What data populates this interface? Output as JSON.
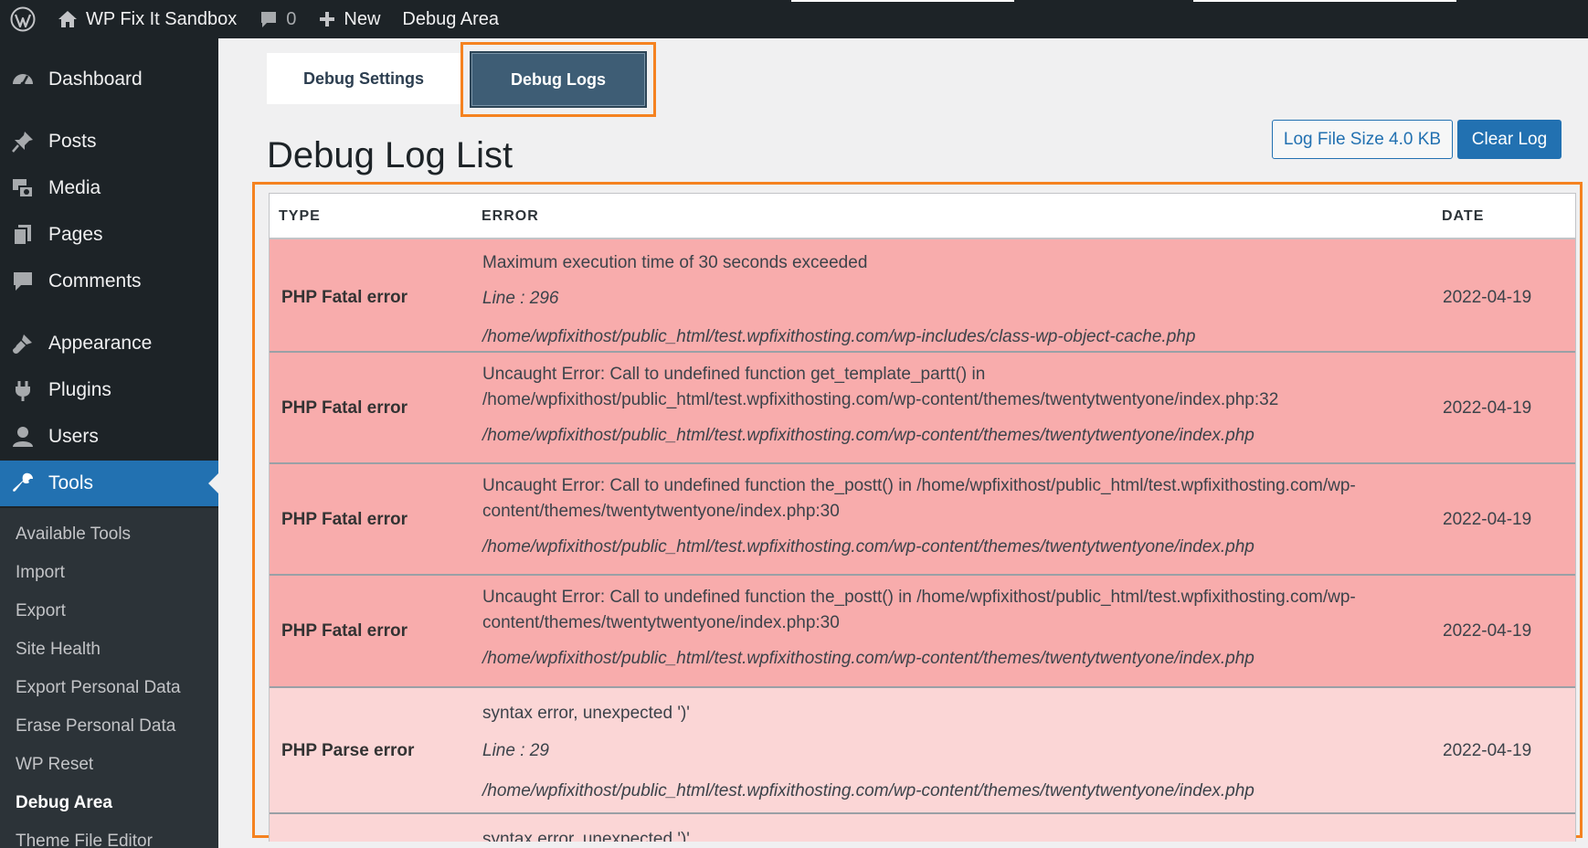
{
  "admin_bar": {
    "site_name": "WP Fix It Sandbox",
    "comments_count": "0",
    "new_label": "New",
    "debug_label": "Debug Area"
  },
  "sidebar": {
    "items": [
      {
        "label": "Dashboard",
        "icon": "dashboard-icon"
      },
      {
        "label": "Posts",
        "icon": "pushpin-icon"
      },
      {
        "label": "Media",
        "icon": "media-icon"
      },
      {
        "label": "Pages",
        "icon": "pages-icon"
      },
      {
        "label": "Comments",
        "icon": "comment-icon"
      },
      {
        "label": "Appearance",
        "icon": "paintbrush-icon"
      },
      {
        "label": "Plugins",
        "icon": "plugin-icon"
      },
      {
        "label": "Users",
        "icon": "user-icon"
      },
      {
        "label": "Tools",
        "icon": "wrench-icon"
      }
    ],
    "submenu": [
      "Available Tools",
      "Import",
      "Export",
      "Site Health",
      "Export Personal Data",
      "Erase Personal Data",
      "WP Reset",
      "Debug Area",
      "Theme File Editor"
    ]
  },
  "tabs": {
    "settings": "Debug Settings",
    "logs": "Debug Logs"
  },
  "page": {
    "title": "Debug Log List",
    "log_size_button": "Log File Size 4.0 KB",
    "clear_button": "Clear Log"
  },
  "table": {
    "headers": {
      "type": "TYPE",
      "error": "ERROR",
      "date": "DATE"
    },
    "rows": [
      {
        "type": "PHP Fatal error",
        "message": "Maximum execution time of 30 seconds exceeded",
        "line": "Line : 296",
        "file": "/home/wpfixithost/public_html/test.wpfixithosting.com/wp-includes/class-wp-object-cache.php",
        "date": "2022-04-19"
      },
      {
        "type": "PHP Fatal error",
        "message": "Uncaught Error: Call to undefined function get_template_partt() in /home/wpfixithost/public_html/test.wpfixithosting.com/wp-content/themes/twentytwentyone/index.php:32",
        "file": "/home/wpfixithost/public_html/test.wpfixithosting.com/wp-content/themes/twentytwentyone/index.php",
        "date": "2022-04-19"
      },
      {
        "type": "PHP Fatal error",
        "message": "Uncaught Error: Call to undefined function the_postt() in /home/wpfixithost/public_html/test.wpfixithosting.com/wp-content/themes/twentytwentyone/index.php:30",
        "file": "/home/wpfixithost/public_html/test.wpfixithosting.com/wp-content/themes/twentytwentyone/index.php",
        "date": "2022-04-19"
      },
      {
        "type": "PHP Fatal error",
        "message": "Uncaught Error: Call to undefined function the_postt() in /home/wpfixithost/public_html/test.wpfixithosting.com/wp-content/themes/twentytwentyone/index.php:30",
        "file": "/home/wpfixithost/public_html/test.wpfixithosting.com/wp-content/themes/twentytwentyone/index.php",
        "date": "2022-04-19"
      },
      {
        "type": "PHP Parse error",
        "message": "syntax error, unexpected ')'",
        "line": "Line : 29",
        "file": "/home/wpfixithost/public_html/test.wpfixithosting.com/wp-content/themes/twentytwentyone/index.php",
        "date": "2022-04-19"
      },
      {
        "message": "syntax error, unexpected ')'"
      }
    ]
  },
  "colors": {
    "admin_bg": "#1d2327",
    "submenu_bg": "#2c3338",
    "accent": "#2271b1",
    "highlight_outline": "#f58220",
    "fatal_row": "#f8acac",
    "parse_row": "#fbd6d6",
    "active_tab": "#3e5d75"
  }
}
